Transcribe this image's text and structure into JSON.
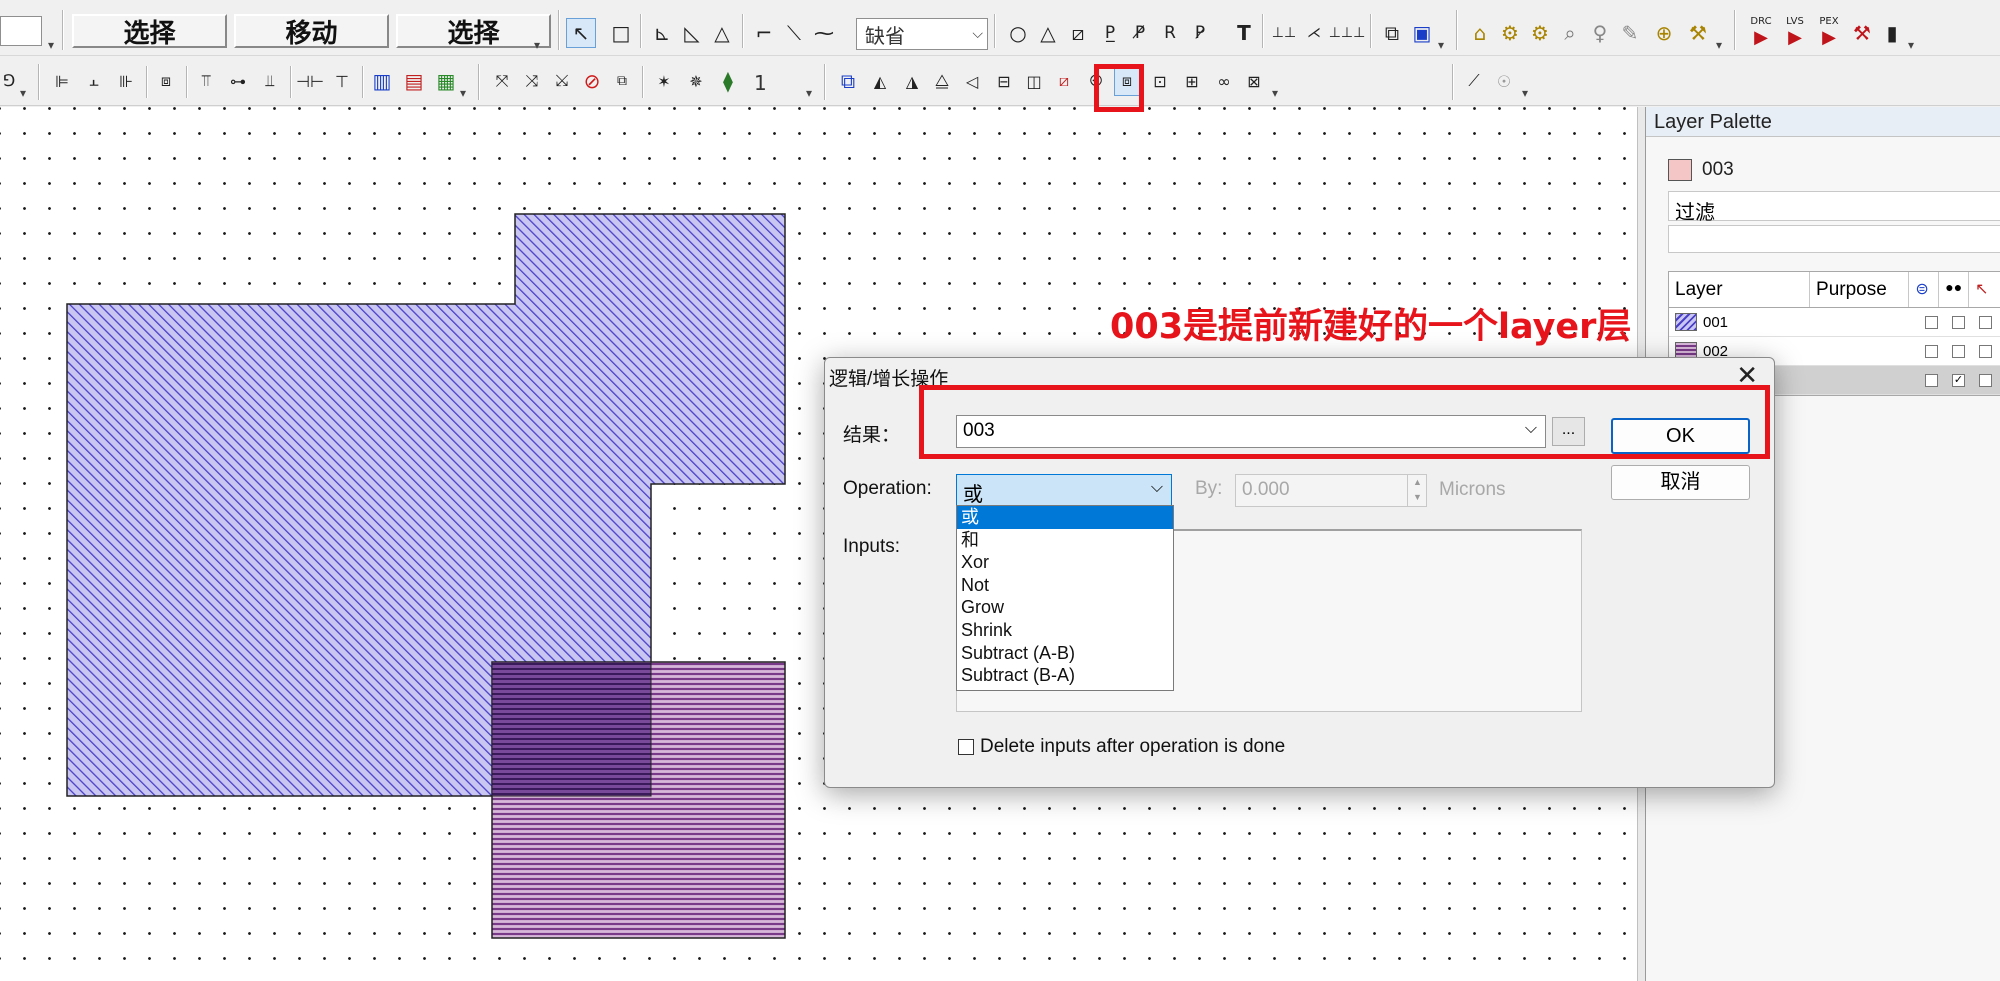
{
  "toolbar1": {
    "mode_buttons": [
      "选择",
      "移动",
      "选择"
    ],
    "style_combo_value": "缺省",
    "verification_labels": [
      "DRC",
      "LVS",
      "PEX"
    ]
  },
  "toolbar2": {
    "count_value": "1"
  },
  "palette": {
    "title": "Layer Palette",
    "current_layer": "003",
    "filter_label": "过滤",
    "col_layer": "Layer",
    "col_purpose": "Purpose",
    "layers": [
      {
        "name": "001",
        "color": "#6b63d8",
        "visible": false
      },
      {
        "name": "002",
        "color": "#b07ab8",
        "visible": false
      },
      {
        "name": "",
        "color": "#d0d0d0",
        "visible": true
      }
    ]
  },
  "dialog": {
    "title": "逻辑/增长操作",
    "result_label": "结果：",
    "result_value": "003",
    "browse_label": "...",
    "ok_label": "OK",
    "cancel_label": "取消",
    "operation_label": "Operation:",
    "operation_value": "或",
    "by_label": "By:",
    "by_value": "0.000",
    "units_label": "Microns",
    "inputs_label": "Inputs:",
    "delete_label": "Delete inputs after operation is done"
  },
  "operation_options": [
    "或",
    "和",
    "Xor",
    "Not",
    "Grow",
    "Shrink",
    "Subtract (A-B)",
    "Subtract (B-A)"
  ],
  "annotation": {
    "text": "003是提前新建好的一个layer层",
    "color": "#e8141b"
  },
  "colors": {
    "layer001": "#4a40c8",
    "layer002": "#7a3a8a",
    "accent": "#0078d7"
  }
}
